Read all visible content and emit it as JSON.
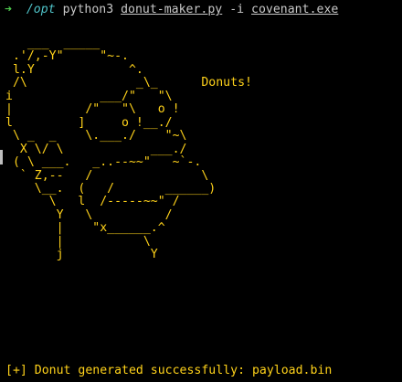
{
  "terminal": {
    "prompt": {
      "arrow": "➜",
      "cwd": "/opt",
      "command": "python3",
      "script": "donut-maker.py",
      "flag": "-i",
      "input_file": "covenant.exe"
    },
    "art_lines": [
      "   ___  _____",
      " .'/,-Y\"     \"~-.",
      " l.Y             ^.",
      " /\\               _\\_      Donuts!",
      "i            ___/\"   \"\\",
      "|          /\"   \"\\   o !",
      "l         ]     o !__./",
      " \\ _  _    \\.___./    \"~\\",
      "  X \\/ \\            ___./",
      " ( \\ ___.   _..--~~\"   ~`-.",
      "  ` Z,--   /               \\",
      "    \\__.  (   /       ______)",
      "      \\   l  /-----~~\" /",
      "       Y   \\          /",
      "       |    \"x______.^",
      "       |           \\",
      "       j            Y"
    ],
    "result": "[+] Donut generated successfully: payload.bin"
  },
  "colors": {
    "background": "#000000",
    "art": "#ffd21a",
    "prompt_arrow": "#4ec94e",
    "prompt_cwd": "#4fc3c8",
    "command_text": "#c8c8c8"
  }
}
